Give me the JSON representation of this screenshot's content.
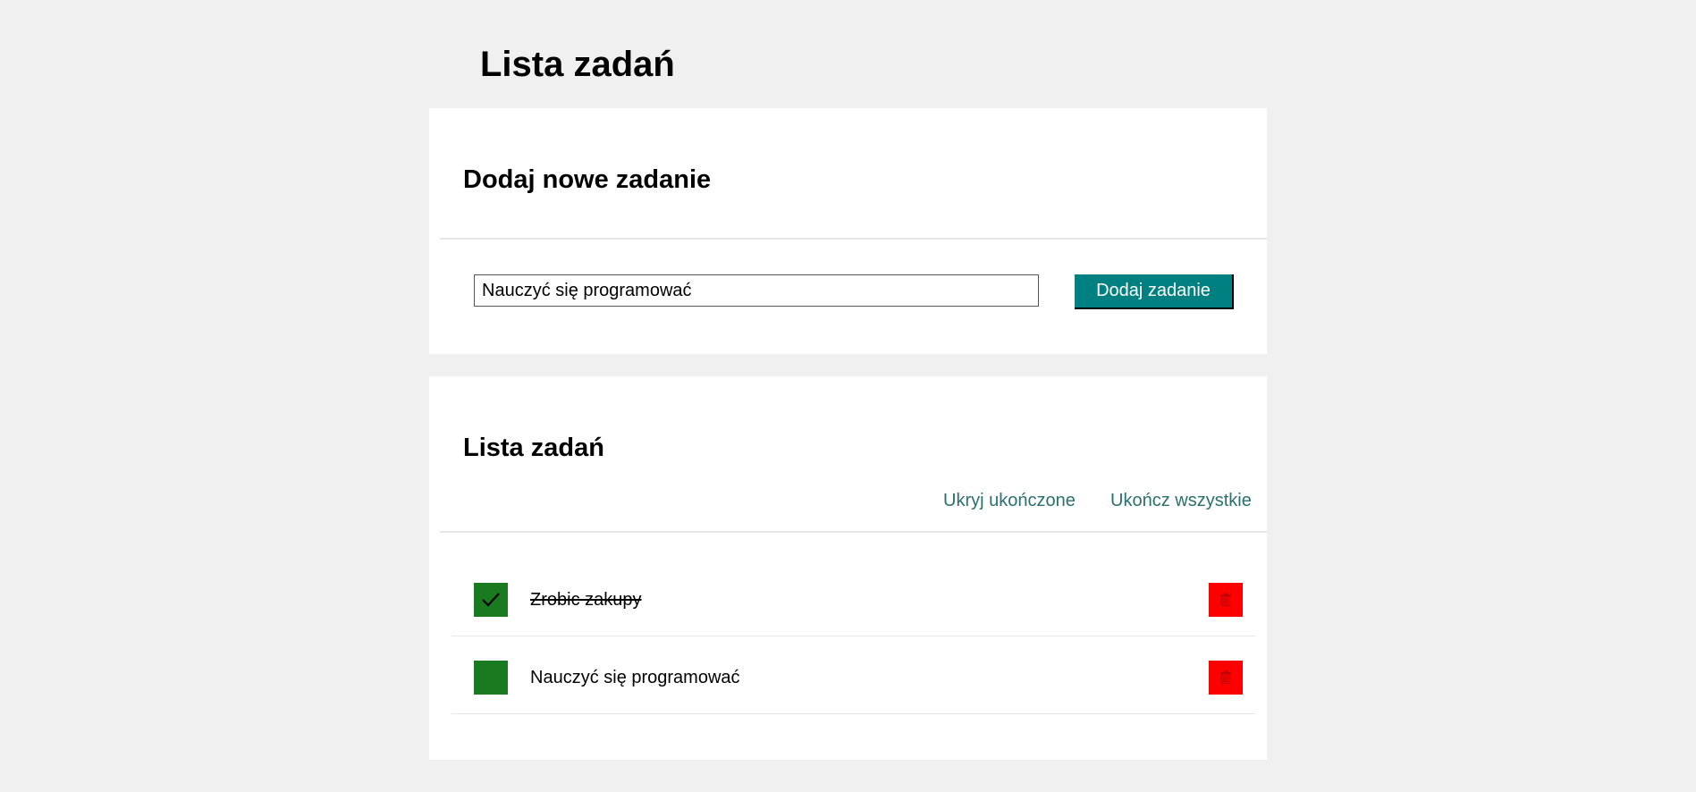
{
  "page": {
    "title": "Lista zadań"
  },
  "add_panel": {
    "heading": "Dodaj nowe zadanie",
    "input_value": "Nauczyć się programować",
    "button_label": "Dodaj zadanie"
  },
  "list_panel": {
    "heading": "Lista zadań",
    "hide_completed_label": "Ukryj ukończone",
    "complete_all_label": "Ukończ wszystkie",
    "tasks": [
      {
        "text": "Zrobic zakupy",
        "done": true,
        "delete_icon": "trash-icon"
      },
      {
        "text": "Nauczyć się programować",
        "done": false,
        "delete_icon": "trash-icon"
      }
    ]
  },
  "colors": {
    "background": "#f0f0f0",
    "panel": "#ffffff",
    "accent": "#008080",
    "link": "#2b6f6f",
    "checkbox": "#1a7a1f",
    "delete": "#ff0000"
  }
}
